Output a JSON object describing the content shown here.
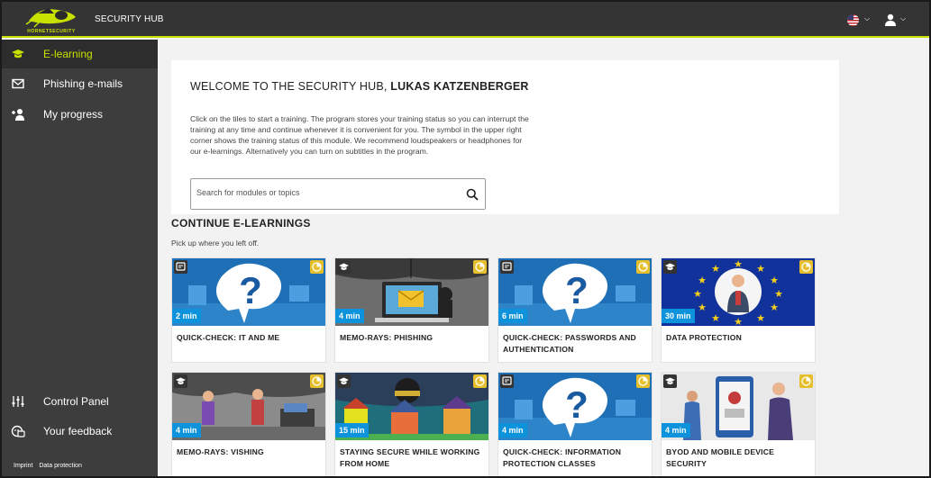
{
  "header": {
    "logo_text": "HORNETSECURITY",
    "app_title": "SECURITY HUB",
    "language_icon": "us-flag-icon",
    "user_icon": "user-icon"
  },
  "sidebar": {
    "items": [
      {
        "label": "E-learning",
        "icon": "graduation-cap-icon"
      },
      {
        "label": "Phishing e-mails",
        "icon": "envelope-icon"
      },
      {
        "label": "My progress",
        "icon": "user-plus-icon"
      }
    ],
    "bottom_items": [
      {
        "label": "Control Panel",
        "icon": "sliders-icon"
      },
      {
        "label": "Your feedback",
        "icon": "feedback-icon"
      }
    ],
    "footer": {
      "imprint": "Imprint",
      "data_protection": "Data protection"
    }
  },
  "welcome": {
    "title_prefix": "WELCOME TO THE SECURITY HUB, ",
    "user_name": "LUKAS KATZENBERGER",
    "description": "Click on the tiles to start a training. The program stores your training status so you can interrupt the training at any time and continue whenever it is convenient for you. The symbol in the upper right corner shows the training status of this module. We recommend loudspeakers or headphones for our e-learnings. Alternatively you can turn on subtitles in the program.",
    "search_placeholder": "Search for modules or topics"
  },
  "section": {
    "title": "CONTINUE E-LEARNINGS",
    "subtitle": "Pick up where you left off."
  },
  "tiles": [
    {
      "title": "QUICK-CHECK: IT AND ME",
      "duration": "2 min",
      "type": "quick-check",
      "art": "question"
    },
    {
      "title": "MEMO-RAYS: PHISHING",
      "duration": "4 min",
      "type": "e-learning",
      "art": "phishing"
    },
    {
      "title": "QUICK-CHECK: PASSWORDS AND AUTHENTICATION",
      "duration": "6 min",
      "type": "quick-check",
      "art": "question"
    },
    {
      "title": "DATA PROTECTION",
      "duration": "30 min",
      "type": "e-learning",
      "art": "eu"
    },
    {
      "title": "MEMO-RAYS: VISHING",
      "duration": "4 min",
      "type": "e-learning",
      "art": "vishing"
    },
    {
      "title": "STAYING SECURE WHILE WORKING FROM HOME",
      "duration": "15 min",
      "type": "e-learning",
      "art": "home"
    },
    {
      "title": "QUICK-CHECK: INFORMATION PROTECTION CLASSES",
      "duration": "4 min",
      "type": "quick-check",
      "art": "question"
    },
    {
      "title": "BYOD AND MOBILE DEVICE SECURITY",
      "duration": "4 min",
      "type": "e-learning",
      "art": "byod"
    }
  ],
  "colors": {
    "accent": "#c8e100",
    "topbar": "#343434",
    "sidebar": "#3d3d3d",
    "duration_badge": "#0d93db",
    "status_badge": "#e6bf2c"
  }
}
